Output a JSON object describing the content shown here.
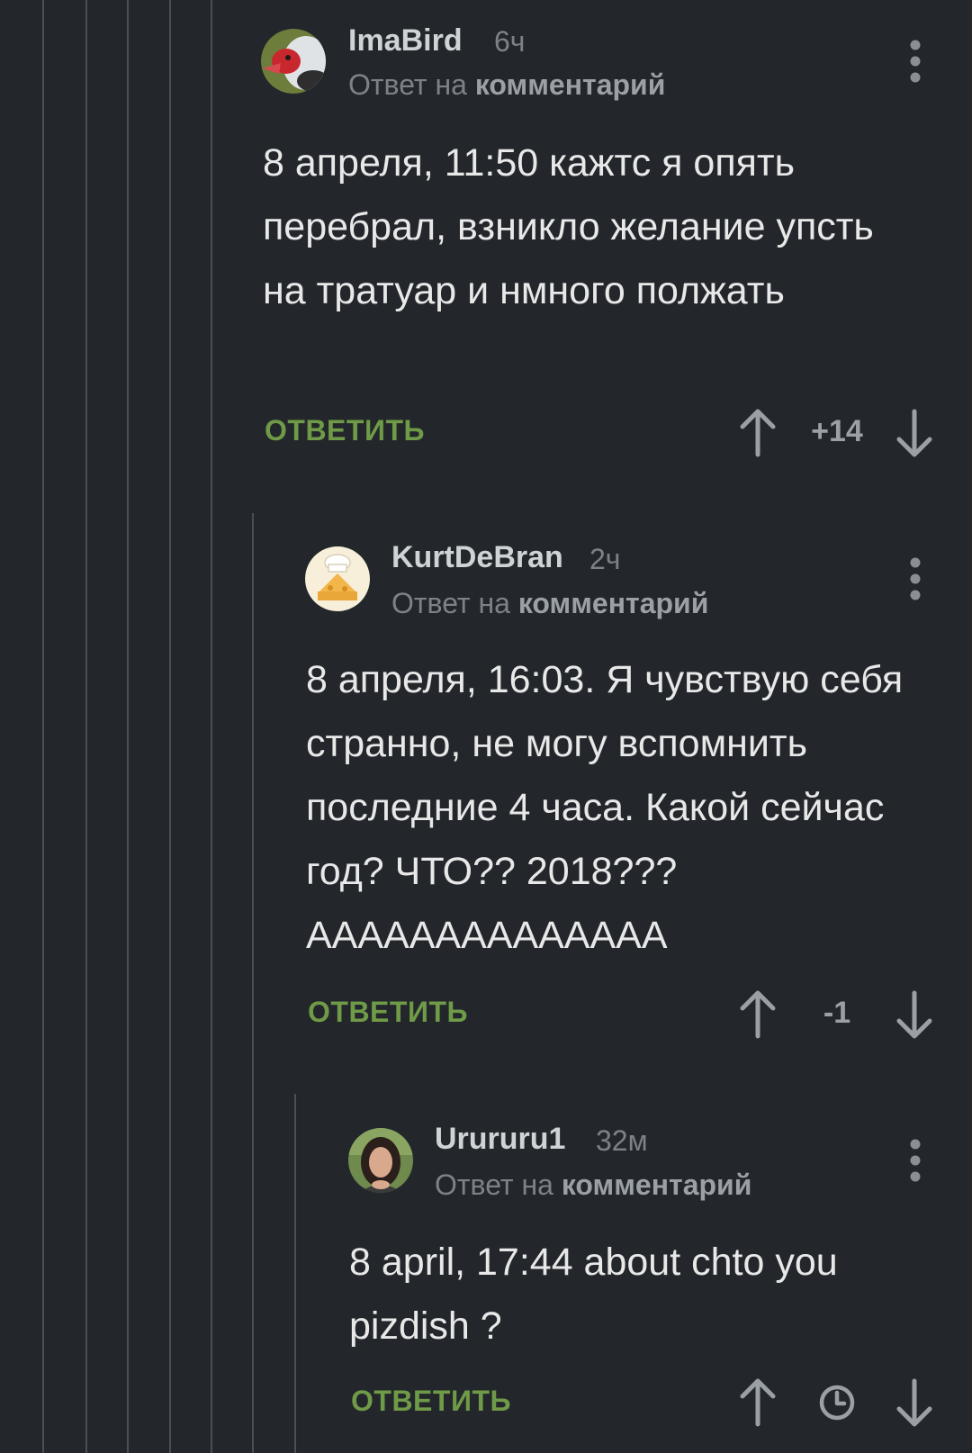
{
  "reply_prefix": "Ответ на",
  "reply_target": "комментарий",
  "reply_button_label": "ОТВЕТИТЬ",
  "icons": {
    "upvote": "arrow-up-icon",
    "downvote": "arrow-down-icon",
    "menu": "vertical-dots-icon",
    "pending": "clock-icon"
  },
  "colors": {
    "background": "#23272b",
    "accent_green": "#6f9a47",
    "muted_text": "#7d8287",
    "thread_line": "#4a4f55"
  },
  "comments": [
    {
      "author": "ImaBird",
      "time": "6ч",
      "body": "8 апреля, 11:50 кажтс я опять перебрал, взникло желание упсть на тратуар и нмного полжать",
      "rating": "+14",
      "avatar": "duck-avatar"
    },
    {
      "author": "KurtDeBran",
      "time": "2ч",
      "body": "8 апреля, 16:03. Я чувствую себя странно, не могу вспомнить последние 4 часа. Какой сейчас год? ЧТО?? 2018??? АААААААААААААА",
      "rating": "-1",
      "avatar": "cheese-chef-avatar"
    },
    {
      "author": "Urururu1",
      "time": "32м",
      "body": "8 april, 17:44 about chto you pizdish ?",
      "rating": "",
      "avatar": "woman-photo-avatar"
    }
  ]
}
